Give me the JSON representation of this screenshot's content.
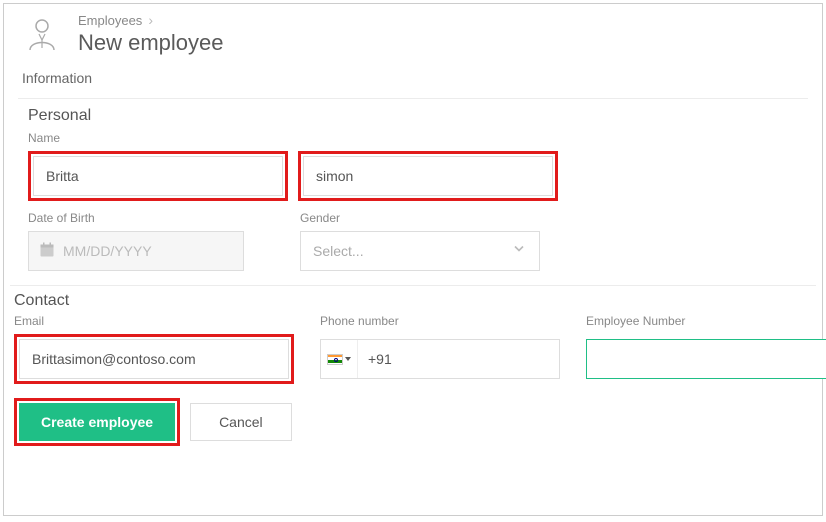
{
  "breadcrumb": {
    "parent": "Employees"
  },
  "page_title": "New employee",
  "tabs": {
    "information": "Information"
  },
  "sections": {
    "personal": "Personal",
    "contact": "Contact"
  },
  "labels": {
    "name": "Name",
    "dob": "Date of Birth",
    "gender": "Gender",
    "email": "Email",
    "phone": "Phone number",
    "empnum": "Employee Number"
  },
  "fields": {
    "first_name": "Britta",
    "last_name": "simon",
    "dob_placeholder": "MM/DD/YYYY",
    "gender_placeholder": "Select...",
    "email": "Brittasimon@contoso.com",
    "phone_code": "+91",
    "empnum": ""
  },
  "buttons": {
    "create": "Create employee",
    "cancel": "Cancel"
  }
}
